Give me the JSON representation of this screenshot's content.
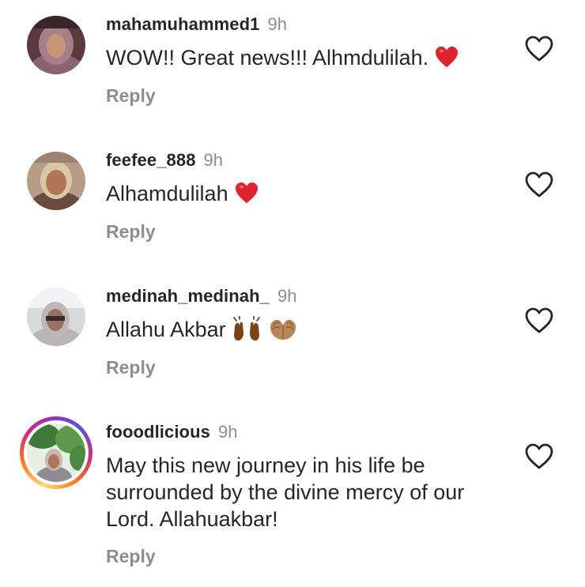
{
  "comments": [
    {
      "username": "mahamuhammed1",
      "time": "9h",
      "text": "WOW!! Great news!!! Alhmdulilah.",
      "emoji": "heart",
      "reply": "Reply"
    },
    {
      "username": "feefee_888",
      "time": "9h",
      "text": "Alhamdulilah",
      "emoji": "heart",
      "reply": "Reply"
    },
    {
      "username": "medinah_medinah_",
      "time": "9h",
      "text": "Allahu Akbar",
      "emoji": "raised-hands, palms-up-together",
      "reply": "Reply"
    },
    {
      "username": "fooodlicious",
      "time": "9h",
      "text_lines": [
        "May this new journey in his life be",
        "surrounded by the divine mercy of our",
        "Lord. Allahuakbar!"
      ],
      "has_story_ring": true,
      "reply": "Reply"
    }
  ],
  "icons": {
    "like": "heart-outline-icon"
  },
  "colors": {
    "text": "#262626",
    "secondary": "#8e8e8e",
    "emoji_heart": "#e0242f"
  }
}
